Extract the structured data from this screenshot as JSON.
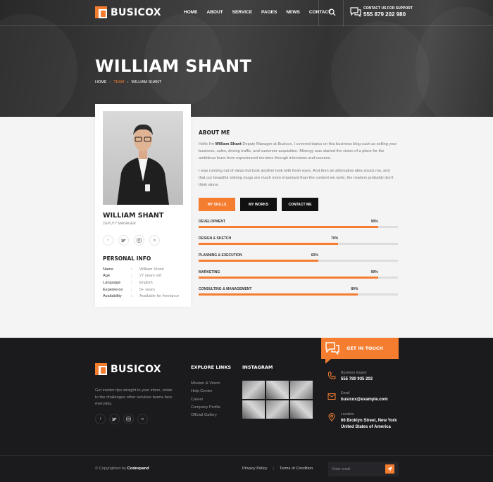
{
  "brand": {
    "name": "BUSICOX",
    "accent": "#f47d30"
  },
  "nav": {
    "items": [
      "HOME",
      "ABOUT",
      "SERVICE",
      "PAGES",
      "NEWS",
      "CONTACT"
    ],
    "support_label": "CONTACT US FOR SUPPORT",
    "support_phone": "555 879 202 980"
  },
  "hero": {
    "title": "WILLIAM SHANT",
    "breadcrumb": [
      "HOME",
      "TEAM",
      "WILLIAM SHANT"
    ]
  },
  "profile": {
    "name": "WILLIAM SHANT",
    "role": "DEPUTY MANAGER",
    "socials": [
      "facebook-icon",
      "twitter-icon",
      "instagram-icon",
      "linkedin-icon"
    ],
    "personal_info_title": "PERSONAL INFO",
    "info": [
      {
        "key": "Name",
        "value": "William Shant"
      },
      {
        "key": "Age",
        "value": "27 years old"
      },
      {
        "key": "Language",
        "value": "English"
      },
      {
        "key": "Experience",
        "value": "5+ years"
      },
      {
        "key": "Availability",
        "value": "Available for freelance"
      }
    ]
  },
  "about": {
    "title": "ABOUT ME",
    "p1_prefix": "Hello I'm ",
    "p1_name": "William Shant",
    "p1_rest": " Deputy Manager at Busicox. I covered topics on this business blog such as selling your business, sales, driving traffic, and customer acquisition. Mixergy was started the vision of a place for the ambitious learn from experienced mentors through interviews and courses.",
    "p2": "I was running out of ideas but took another look with fresh eyes. And then an alternative idea struck me, and that our beautiful shining mugs are much more important than the content we write, the readers probably don't think alone.",
    "tabs": [
      "MY SKILLS",
      "MY WORKS",
      "CONTACT ME"
    ],
    "active_tab": 0
  },
  "skills": [
    {
      "name": "DEVELOPMENT",
      "percent": 90,
      "label": "90%"
    },
    {
      "name": "DESIGN & SKETCH",
      "percent": 70,
      "label": "70%"
    },
    {
      "name": "PLANNING & EXECUTION",
      "percent": 60,
      "label": "60%"
    },
    {
      "name": "MARKETING",
      "percent": 90,
      "label": "90%"
    },
    {
      "name": "CONSULTING & MANAGEMENT",
      "percent": 80,
      "label": "80%"
    }
  ],
  "footer": {
    "get_in_touch": "GET IN TOUCH",
    "about_text": "Get insider tips straight to your inbox, relate to the challenges other services teams face everyday.",
    "explore_title": "EXPLORE LINKS",
    "links": [
      "Mission & Vision",
      "Help Center",
      "Career",
      "Company Profile",
      "Official Gallery"
    ],
    "instagram_title": "INSTAGRAM",
    "contacts": [
      {
        "label": "Business Inquiry",
        "value": "555 780 935 202",
        "icon": "phone-icon"
      },
      {
        "label": "Email",
        "value": "busicox@example.com",
        "icon": "mail-icon"
      },
      {
        "label": "Location",
        "value": "66 Broklyn Street, New York United States of America",
        "icon": "location-icon"
      }
    ],
    "copyright_prefix": "© Copyrighted by ",
    "copyright_owner": "Codexpand",
    "privacy": "Privacy Policy",
    "separator": "|",
    "terms": "Terms of Condition",
    "newsletter_placeholder": "Enter email"
  }
}
